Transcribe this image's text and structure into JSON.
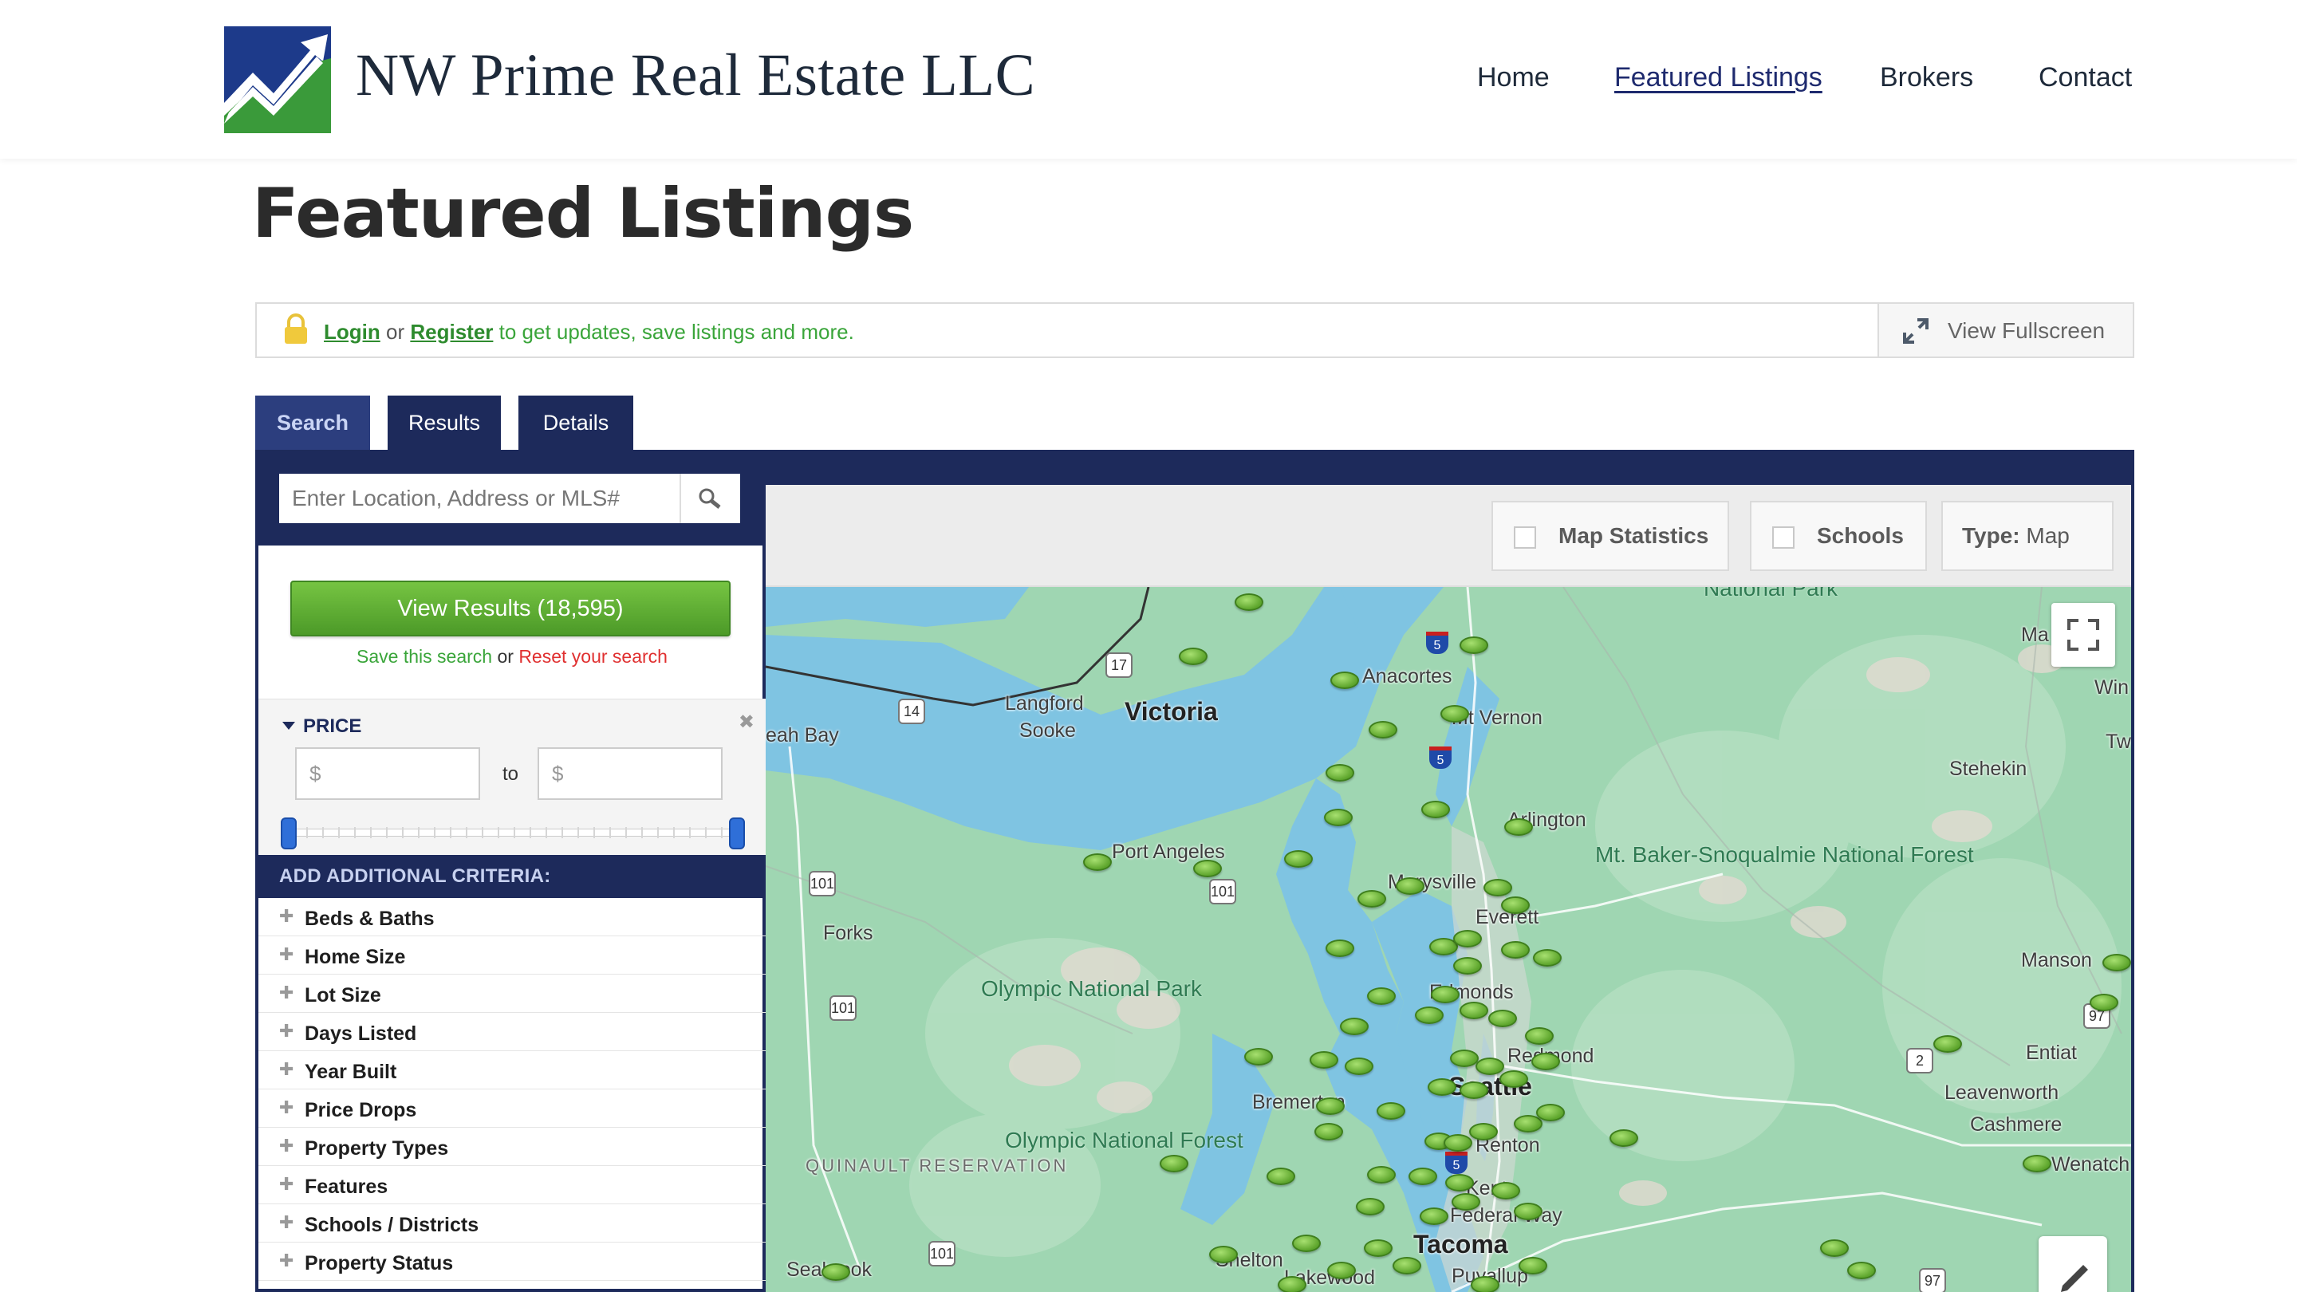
{
  "header": {
    "logo_text": "NW Prime Real Estate LLC",
    "nav": [
      {
        "label": "Home",
        "active": false
      },
      {
        "label": "Featured Listings",
        "active": true
      },
      {
        "label": "Brokers",
        "active": false
      },
      {
        "label": "Contact",
        "active": false
      }
    ]
  },
  "page_title": "Featured Listings",
  "login_bar": {
    "login": "Login",
    "or": "or",
    "register": "Register",
    "suffix": "to get updates, save listings and more.",
    "fullscreen": "View Fullscreen"
  },
  "tabs": [
    {
      "label": "Search",
      "active": true
    },
    {
      "label": "Results",
      "active": false
    },
    {
      "label": "Details",
      "active": false
    }
  ],
  "search": {
    "placeholder": "Enter Location, Address or MLS#",
    "view_results": "View Results (18,595)",
    "save_search": "Save this search",
    "or": "or",
    "reset_search": "Reset your search"
  },
  "price": {
    "label": "PRICE",
    "close": "✖",
    "min_placeholder": "$",
    "to": "to",
    "max_placeholder": "$"
  },
  "criteria": {
    "header": "ADD ADDITIONAL CRITERIA:",
    "items": [
      "Beds & Baths",
      "Home Size",
      "Lot Size",
      "Days Listed",
      "Year Built",
      "Price Drops",
      "Property Types",
      "Features",
      "Schools / Districts",
      "Property Status"
    ]
  },
  "map_toolbar": {
    "map_statistics": "Map Statistics",
    "schools": "Schools",
    "type_label": "Type:",
    "type_value": "Map"
  },
  "map": {
    "labels": {
      "langford": "Langford",
      "sooke": "Sooke",
      "victoria": "Victoria",
      "neah_bay": "eah Bay",
      "anacortes": "Anacortes",
      "mt_vernon": "Mt Vernon",
      "arlington": "Arlington",
      "port_angeles": "Port Angeles",
      "forks": "Forks",
      "marysville": "Marysville",
      "everett": "Everett",
      "edmonds": "Edmonds",
      "redmond": "Redmond",
      "seattle": "Seattle",
      "bremerton": "Bremerton",
      "renton": "Renton",
      "kent": "Kent",
      "federal_way": "Federal Way",
      "tacoma": "Tacoma",
      "shelton": "Shelton",
      "lakewood": "Lakewood",
      "puyallup": "Puyallup",
      "seabrook": "Seabrook",
      "stehekin": "Stehekin",
      "manson": "Manson",
      "entiat": "Entiat",
      "leavenworth": "Leavenworth",
      "cashmere": "Cashmere",
      "wenatchee": "Wenatch",
      "winthrop": "Win",
      "twisp": "Tw",
      "mazama": "Ma",
      "olympic_np": "Olympic National Park",
      "olympic_nf": "Olympic National Forest",
      "baker": "Mt. Baker-Snoqualmie National Forest",
      "quinault": "QUINAULT RESERVATION",
      "national_park_top": "National Park"
    },
    "highways": [
      "17",
      "14",
      "101",
      "101",
      "101",
      "101",
      "2",
      "97",
      "97",
      "5",
      "5",
      "5"
    ]
  },
  "colors": {
    "navy": "#1d2a5b",
    "green": "#4c9a28",
    "link_green": "#3aa53a",
    "reset_red": "#e03030",
    "water": "#7fc4e2",
    "land": "#9fd6b2"
  },
  "icons": [
    "lock-icon",
    "expand-icon",
    "search-icon",
    "fullscreen-icon",
    "pencil-icon",
    "chart-logo-icon"
  ]
}
